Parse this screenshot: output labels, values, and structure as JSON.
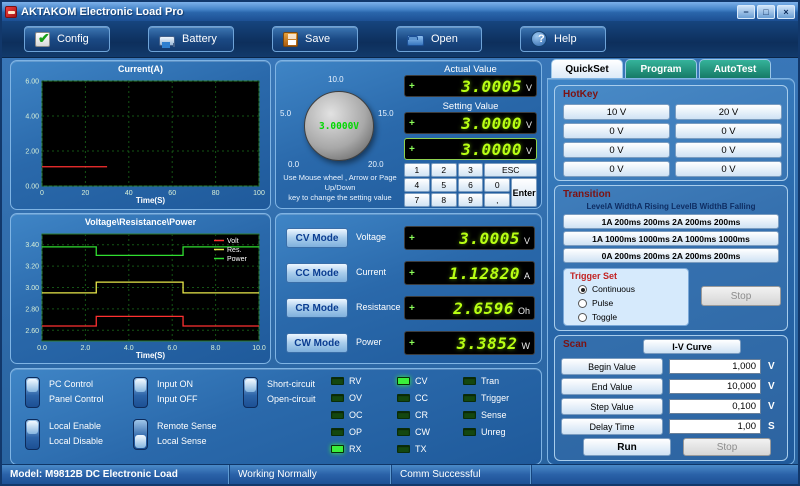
{
  "window": {
    "title": "AKTAKOM Electronic Load Pro",
    "minimize": "−",
    "maximize": "□",
    "close": "×"
  },
  "toolbar": {
    "items": [
      {
        "label": "Config",
        "icon": "config-icon"
      },
      {
        "label": "Battery",
        "icon": "battery-icon"
      },
      {
        "label": "Save",
        "icon": "save-icon"
      },
      {
        "label": "Open",
        "icon": "open-icon"
      },
      {
        "label": "Help",
        "icon": "help-icon"
      }
    ]
  },
  "chart_data": [
    {
      "type": "line",
      "title": "Current(A)",
      "xlabel": "Time(S)",
      "xlim": [
        0,
        100
      ],
      "ylim": [
        0,
        6
      ],
      "x_ticks": [
        "0",
        "20",
        "40",
        "60",
        "80",
        "100"
      ],
      "y_ticks": [
        "6.00",
        "4.00",
        "2.00",
        "0.00"
      ],
      "grid": true,
      "series": [
        {
          "name": "Current",
          "color": "#ff3030",
          "x": [
            0,
            30
          ],
          "y": [
            1.1,
            1.1
          ]
        }
      ]
    },
    {
      "type": "line",
      "title": "Voltage\\Resistance\\Power",
      "xlabel": "Time(S)",
      "xlim": [
        0,
        10
      ],
      "ylim": [
        2.5,
        3.5
      ],
      "x_ticks": [
        "0.0",
        "2.0",
        "4.0",
        "6.0",
        "8.0",
        "10.0"
      ],
      "y_ticks": [
        "3.40",
        "3.20",
        "3.00",
        "2.80",
        "2.60"
      ],
      "grid": true,
      "legend": [
        {
          "name": "Volt",
          "color": "#ff3030"
        },
        {
          "name": "Res.",
          "color": "#e8e84a"
        },
        {
          "name": "Power",
          "color": "#30dd30"
        }
      ],
      "series": [
        {
          "name": "Volt",
          "color": "#ff3030",
          "x": [
            0,
            2.5,
            2.5,
            6.5,
            6.5,
            10
          ],
          "y": [
            2.64,
            2.64,
            2.73,
            2.73,
            2.64,
            2.64
          ]
        },
        {
          "name": "Res.",
          "color": "#e8e84a",
          "x": [
            0,
            2.5,
            2.5,
            6.5,
            6.5,
            10
          ],
          "y": [
            2.95,
            2.95,
            3.05,
            3.05,
            2.95,
            2.95
          ]
        },
        {
          "name": "Power",
          "color": "#30dd30",
          "x": [
            0,
            2.5,
            2.5,
            6.5,
            6.5,
            10
          ],
          "y": [
            3.38,
            3.38,
            3.3,
            3.3,
            3.38,
            3.38
          ]
        }
      ]
    }
  ],
  "setter": {
    "knob": {
      "value": "3.0000V",
      "scale": [
        "0.0",
        "5.0",
        "10.0",
        "15.0",
        "20.0"
      ]
    },
    "hint_line1": "Use Mouse wheel , Arrow or Page Up/Down",
    "hint_line2": "key to change the setting value",
    "actual": {
      "label": "Actual Value",
      "sign": "+",
      "value": "3.0005",
      "unit": "V"
    },
    "setting": {
      "label": "Setting Value",
      "sign": "+",
      "value": "3.0000",
      "unit": "V"
    },
    "entry": {
      "sign": "+",
      "value": "3.0000",
      "unit": "V"
    },
    "keypad": {
      "keys": [
        "1",
        "2",
        "3",
        "ESC",
        "4",
        "5",
        "6",
        "0",
        "7",
        "8",
        "9",
        ","
      ],
      "enter": "Enter"
    }
  },
  "modes": {
    "rows": [
      {
        "button": "CV Mode",
        "label": "Voltage",
        "sign": "+",
        "value": "3.0005",
        "unit": "V"
      },
      {
        "button": "CC Mode",
        "label": "Current",
        "sign": "+",
        "value": "1.12820",
        "unit": "A"
      },
      {
        "button": "CR Mode",
        "label": "Resistance",
        "sign": "+",
        "value": "2.6596",
        "unit": "Oh"
      },
      {
        "button": "CW Mode",
        "label": "Power",
        "sign": "+",
        "value": "3.3852",
        "unit": "W"
      }
    ]
  },
  "controls": {
    "toggles": [
      {
        "top": "PC Control",
        "bottom": "Panel Control",
        "state": "up"
      },
      {
        "top": "Local Enable",
        "bottom": "Local Disable",
        "state": "up"
      },
      {
        "top": "Input ON",
        "bottom": "Input OFF",
        "state": "up"
      },
      {
        "top": "Remote Sense",
        "bottom": "Local Sense",
        "state": "down"
      },
      {
        "top": "Short-circuit",
        "bottom": "Open-circuit",
        "state": "up"
      }
    ],
    "indicators": {
      "col1": [
        {
          "label": "RV",
          "on": false
        },
        {
          "label": "OV",
          "on": false
        },
        {
          "label": "OC",
          "on": false
        },
        {
          "label": "OP",
          "on": false
        },
        {
          "label": "RX",
          "on": true
        }
      ],
      "col2": [
        {
          "label": "CV",
          "on": true
        },
        {
          "label": "CC",
          "on": false
        },
        {
          "label": "CR",
          "on": false
        },
        {
          "label": "CW",
          "on": false
        },
        {
          "label": "TX",
          "on": false
        }
      ],
      "col3": [
        {
          "label": "Tran",
          "on": false
        },
        {
          "label": "Trigger",
          "on": false
        },
        {
          "label": "Sense",
          "on": false
        },
        {
          "label": "Unreg",
          "on": false
        }
      ]
    }
  },
  "right": {
    "tabs": [
      {
        "label": "QuickSet",
        "active": true
      },
      {
        "label": "Program",
        "active": false
      },
      {
        "label": "AutoTest",
        "active": false
      }
    ],
    "hotkey": {
      "title": "HotKey",
      "buttons": [
        "10 V",
        "20 V",
        "0 V",
        "0 V",
        "0 V",
        "0 V",
        "0 V",
        "0 V"
      ]
    },
    "transition": {
      "title": "Transition",
      "header": "LevelA WidthA Rising LevelB WidthB Falling",
      "presets": [
        "1A 200ms 200ms 2A 200ms 200ms",
        "1A 1000ms 1000ms 2A 1000ms 1000ms",
        "0A 200ms 200ms 2A 200ms 200ms"
      ],
      "trigger_title": "Trigger Set",
      "trigger_options": [
        {
          "label": "Continuous",
          "selected": true
        },
        {
          "label": "Pulse",
          "selected": false
        },
        {
          "label": "Toggle",
          "selected": false
        }
      ],
      "stop_label": "Stop"
    },
    "scan": {
      "title": "Scan",
      "curve_button": "I-V Curve",
      "rows": [
        {
          "label": "Begin Value",
          "value": "1,000",
          "unit": "V"
        },
        {
          "label": "End Value",
          "value": "10,000",
          "unit": "V"
        },
        {
          "label": "Step Value",
          "value": "0,100",
          "unit": "V"
        },
        {
          "label": "Delay Time",
          "value": "1,00",
          "unit": "S"
        }
      ],
      "run_label": "Run",
      "stop_label": "Stop"
    }
  },
  "statusbar": {
    "model": "Model: M9812B DC Electronic Load",
    "status": "Working Normally",
    "comm": "Comm Successful"
  }
}
